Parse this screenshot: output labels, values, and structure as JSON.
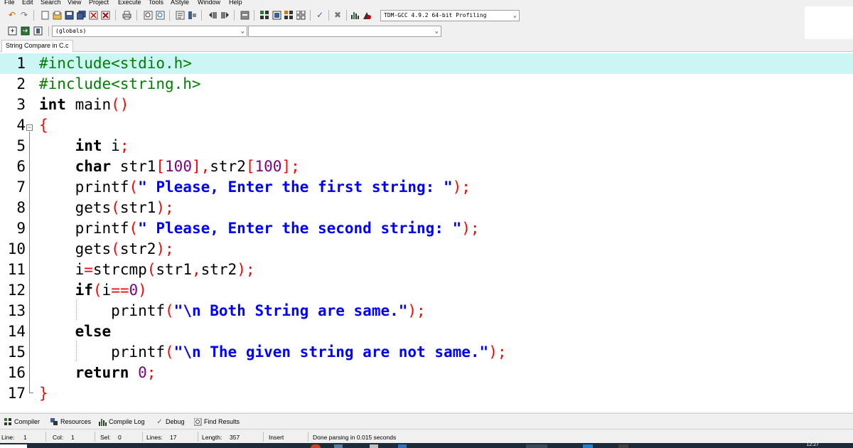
{
  "menu": [
    "File",
    "Edit",
    "Search",
    "View",
    "Project",
    "Execute",
    "Tools",
    "AStyle",
    "Window",
    "Help"
  ],
  "toolbar": {
    "compiler_select": "TDM-GCC 4.9.2 64-bit Profiling",
    "scope_select": "(globals)",
    "function_select": ""
  },
  "tab": {
    "label": "String Compare in C.c"
  },
  "editor": {
    "current_line": 1,
    "line_numbers": [
      "1",
      "2",
      "3",
      "4",
      "5",
      "6",
      "7",
      "8",
      "9",
      "10",
      "11",
      "12",
      "13",
      "14",
      "15",
      "16",
      "17"
    ]
  },
  "bottom_tabs": [
    "Compiler",
    "Resources",
    "Compile Log",
    "Debug",
    "Find Results"
  ],
  "status": {
    "line_label": "Line:",
    "line_value": "1",
    "col_label": "Col:",
    "col_value": "1",
    "sel_label": "Sel:",
    "sel_value": "0",
    "lines_label": "Lines:",
    "lines_value": "17",
    "length_label": "Length:",
    "length_value": "357",
    "mode": "Insert",
    "message": "Done parsing in 0.015 seconds"
  },
  "taskbar": {
    "clock": "12:27"
  },
  "code_lines": [
    [
      [
        "pp",
        "#include<stdio.h>"
      ]
    ],
    [
      [
        "pp",
        "#include<string.h>"
      ]
    ],
    [
      [
        "kw",
        "int"
      ],
      [
        "t",
        " main"
      ],
      [
        "sym",
        "()"
      ]
    ],
    [
      [
        "sym",
        "{"
      ]
    ],
    [
      [
        "t",
        "    "
      ],
      [
        "kw",
        "int"
      ],
      [
        "t",
        " i"
      ],
      [
        "sym",
        ";"
      ]
    ],
    [
      [
        "t",
        "    "
      ],
      [
        "kw",
        "char"
      ],
      [
        "t",
        " str1"
      ],
      [
        "sym",
        "["
      ],
      [
        "num",
        "100"
      ],
      [
        "sym",
        "],"
      ],
      [
        "t",
        "str2"
      ],
      [
        "sym",
        "["
      ],
      [
        "num",
        "100"
      ],
      [
        "sym",
        "];"
      ]
    ],
    [
      [
        "t",
        "    printf"
      ],
      [
        "sym",
        "("
      ],
      [
        "str",
        "\" Please, Enter the first string: \""
      ],
      [
        "sym",
        ");"
      ]
    ],
    [
      [
        "t",
        "    gets"
      ],
      [
        "sym",
        "("
      ],
      [
        "t",
        "str1"
      ],
      [
        "sym",
        ");"
      ]
    ],
    [
      [
        "t",
        "    printf"
      ],
      [
        "sym",
        "("
      ],
      [
        "str",
        "\" Please, Enter the second string: \""
      ],
      [
        "sym",
        ");"
      ]
    ],
    [
      [
        "t",
        "    gets"
      ],
      [
        "sym",
        "("
      ],
      [
        "t",
        "str2"
      ],
      [
        "sym",
        ");"
      ]
    ],
    [
      [
        "t",
        "    i"
      ],
      [
        "sym",
        "="
      ],
      [
        "t",
        "strcmp"
      ],
      [
        "sym",
        "("
      ],
      [
        "t",
        "str1"
      ],
      [
        "sym",
        ","
      ],
      [
        "t",
        "str2"
      ],
      [
        "sym",
        ");"
      ]
    ],
    [
      [
        "t",
        "    "
      ],
      [
        "kw",
        "if"
      ],
      [
        "sym",
        "("
      ],
      [
        "t",
        "i"
      ],
      [
        "sym",
        "=="
      ],
      [
        "num",
        "0"
      ],
      [
        "sym",
        ")"
      ]
    ],
    [
      [
        "t",
        "        printf"
      ],
      [
        "sym",
        "("
      ],
      [
        "str",
        "\"\\n Both String are same.\""
      ],
      [
        "sym",
        ");"
      ]
    ],
    [
      [
        "t",
        "    "
      ],
      [
        "kw",
        "else"
      ]
    ],
    [
      [
        "t",
        "        printf"
      ],
      [
        "sym",
        "("
      ],
      [
        "str",
        "\"\\n The given string are not same.\""
      ],
      [
        "sym",
        ");"
      ]
    ],
    [
      [
        "t",
        "    "
      ],
      [
        "kw",
        "return"
      ],
      [
        "t",
        " "
      ],
      [
        "num",
        "0"
      ],
      [
        "sym",
        ";"
      ]
    ],
    [
      [
        "sym",
        "}"
      ]
    ]
  ],
  "colors": {
    "preprocessor": "#008000",
    "symbol": "#ff0000",
    "number": "#800080",
    "string": "#0000ff",
    "current_line": "#ccf6f6"
  }
}
